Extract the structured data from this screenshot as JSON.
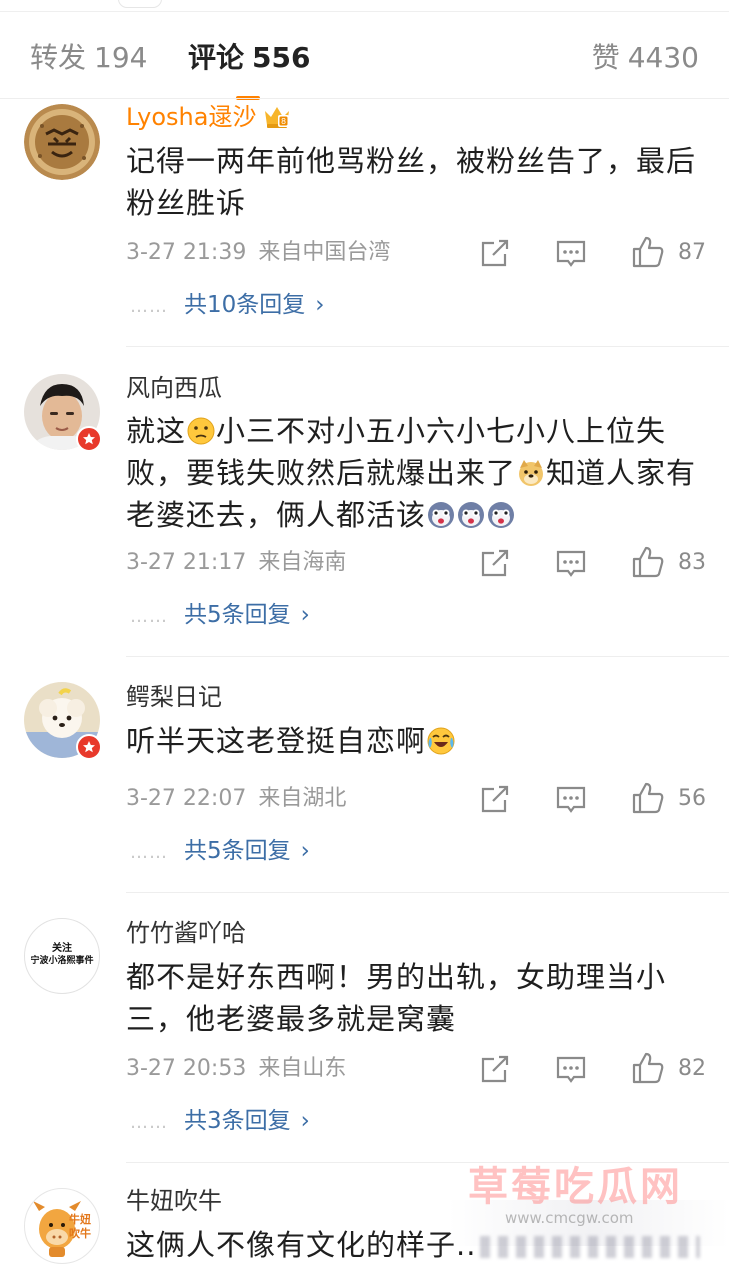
{
  "tabs": {
    "repost": {
      "label": "转发",
      "count": "194"
    },
    "comments": {
      "label": "评论",
      "count": "556"
    },
    "likes": {
      "label": "赞",
      "count": "4430"
    }
  },
  "colors": {
    "accent": "#ff8200",
    "link": "#3d6ea6",
    "vip_name": "#ff8200",
    "badge": "#e8392b"
  },
  "comments": [
    {
      "user": "Lyosha逯沙",
      "vip_crown": true,
      "text": "记得一两年前他骂粉丝，被粉丝告了，最后粉丝胜诉",
      "time": "3-27 21:39",
      "source": "来自中国台湾",
      "likes": "87",
      "replies": "共10条回复"
    },
    {
      "user": "风向西瓜",
      "text_parts": [
        "就这",
        "小三不对小五小六小七小八上位失败，要钱失败然后就爆出来了",
        "知道人家有老婆还去，俩人都活该"
      ],
      "emojis": [
        "confused-face-emoji",
        "doge-emoji",
        "husky-emoji",
        "husky-emoji",
        "husky-emoji"
      ],
      "time": "3-27 21:17",
      "source": "来自海南",
      "likes": "83",
      "replies": "共5条回复"
    },
    {
      "user": "鳄梨日记",
      "text": "听半天这老登挺自恋啊",
      "emojis": [
        "laugh-cry-emoji"
      ],
      "time": "3-27 22:07",
      "source": "来自湖北",
      "likes": "56",
      "replies": "共5条回复"
    },
    {
      "user": "竹竹酱吖哈",
      "avatar_text": [
        "关注",
        "宁波小洛熙事件"
      ],
      "text": "都不是好东西啊！男的出轨，女助理当小三，他老婆最多就是窝囊",
      "time": "3-27 20:53",
      "source": "来自山东",
      "likes": "82",
      "replies": "共3条回复"
    },
    {
      "user": "牛妞吹牛",
      "avatar_text": [
        "牛妞",
        "吹牛"
      ],
      "text": "这俩人不像有文化的样子.."
    }
  ],
  "watermark": {
    "title": "草莓吃瓜网",
    "url": "www.cmcgw.com"
  }
}
